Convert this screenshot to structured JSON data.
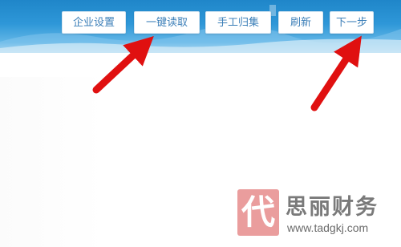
{
  "toolbar": {
    "buttons": [
      {
        "label": "企业设置"
      },
      {
        "label": "一键读取"
      },
      {
        "label": "手工归集"
      },
      {
        "label": "刷新"
      },
      {
        "label": "下一步"
      }
    ]
  },
  "watermark": {
    "seal_char": "代",
    "name": "思丽财务",
    "url": "www.tadgkj.com"
  },
  "colors": {
    "banner_blue": "#2e97d8",
    "button_text": "#3c7fb8",
    "arrow_red": "#e01010"
  }
}
